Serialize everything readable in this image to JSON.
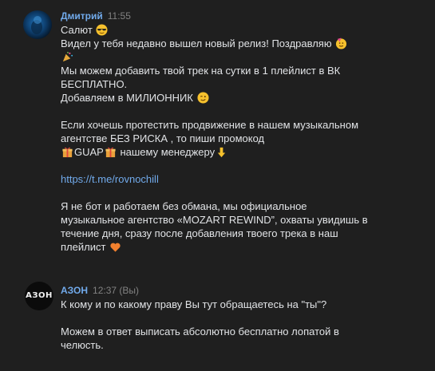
{
  "messages": [
    {
      "author": "Дмитрий",
      "time": "11:55",
      "lines": {
        "l1": "Салют",
        "l2": "Видел у тебя недавно вышел новый релиз! Поздравляю",
        "l4": "Мы можем добавить твой трек на сутки в 1 плейлист в ВК",
        "l5": "БЕСПЛАТНО.",
        "l6": "Добавляем в МИЛИОННИК",
        "l8": "Если хочешь протестить продвижение в нашем музыкальном",
        "l9": "агентстве БЕЗ РИСКА , то пиши промокод",
        "l10_code": "GUAP",
        "l10_rest": "нашему менеджеру",
        "l12_link": "https://t.me/rovnochill",
        "l14": "Я не бот и работаем без обмана, мы официальное",
        "l15": "музыкальное агентство «MOZART REWIND”, охваты увидишь в",
        "l16": "течение дня, сразу после добавления твоего трека в наш",
        "l17": "плейлист"
      }
    },
    {
      "author": "АЗОН",
      "time": "12:37 (Вы)",
      "avatar_text": "АЗОН",
      "lines": {
        "l1": "К кому и по какому праву Вы тут обращаетесь на \"ты\"?",
        "l3": "Можем в ответ выписать абсолютно бесплатно лопатой в",
        "l4": "челюсть."
      }
    }
  ],
  "emojis": {
    "sunglasses": "sunglasses-emoji",
    "party_face": "partying-face-emoji",
    "party_popper": "party-popper-emoji",
    "wink": "winking-face-emoji",
    "gift": "gift-emoji",
    "point_down": "backhand-index-pointing-down-emoji",
    "orange_heart": "orange-heart-emoji"
  },
  "colors": {
    "background": "#1f1f1f",
    "author": "#71aaeb",
    "text": "#e1e3e6",
    "time": "#828282",
    "link": "#71aaeb"
  }
}
